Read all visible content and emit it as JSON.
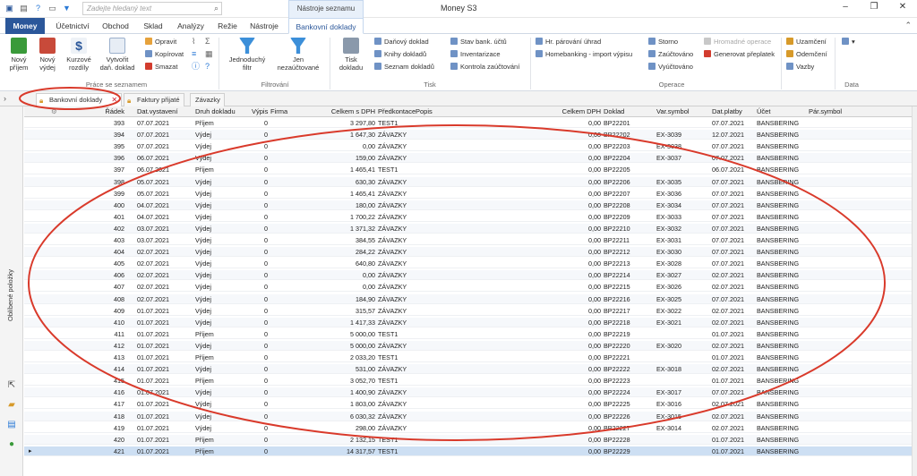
{
  "titlebar": {
    "search_placeholder": "Zadejte hledaný text",
    "app_title": "Money S3",
    "context_title": "Nástroje seznamu"
  },
  "ribbon_tabs": [
    "Money",
    "Účetnictví",
    "Obchod",
    "Sklad",
    "Analýzy",
    "Režie",
    "Nástroje",
    "Bankovní doklady"
  ],
  "ribbon": {
    "novy_prijem": "Nový",
    "novy_prijem2": "příjem",
    "novy_vydej": "Nový",
    "novy_vydej2": "výdej",
    "kurzove": "Kurzové",
    "kurzove2": "rozdíly",
    "vytvorit": "Vytvořit",
    "vytvorit2": "daň. doklad",
    "opravit": "Opravit",
    "kopirovat": "Kopírovat",
    "smazat": "Smazat",
    "group_prace": "Práce se seznamem",
    "jednoduchy": "Jednoduchý",
    "jednoduchy2": "filtr",
    "jen_nezauctovane": "Jen",
    "jen_nezauctovane2": "nezaúčtované",
    "group_filtrovani": "Filtrování",
    "tisk": "Tisk",
    "tisk2": "dokladu",
    "danovy_doklad": "Daňový doklad",
    "knihy_dokladu": "Knihy dokladů",
    "seznam_dokladu": "Seznam dokladů",
    "stav_bank": "Stav bank. účtů",
    "inventarizace": "Inventarizace",
    "kontrola": "Kontrola zaúčtování",
    "group_tisk": "Tisk",
    "hr_parovani": "Hr. párování úhrad",
    "homebanking": "Homebanking - import výpisu",
    "storno": "Storno",
    "zauctovano": "Zaúčtováno",
    "vyuctovano": "Vyúčtováno",
    "hromadne": "Hromadné operace",
    "generovat": "Generovat přeplatek",
    "group_operace": "Operace",
    "uzamceni": "Uzamčení",
    "odemceni": "Odemčení",
    "vazby": "Vazby",
    "group_data": "Data"
  },
  "doc_tabs": [
    "Bankovní doklady",
    "Faktury přijaté",
    "Závazky"
  ],
  "left_panel": {
    "label": "Oblíbené položky"
  },
  "columns": [
    "Řádek",
    "Dat.vystavení",
    "Druh dokladu",
    "Výpis",
    "Firma",
    "Celkem s DPH",
    "Předkontace",
    "Popis",
    "Celkem DPH",
    "Doklad",
    "Var.symbol",
    "Dat.platby",
    "Účet",
    "Pár.symbol"
  ],
  "rows": [
    [
      "393",
      "07.07.2021",
      "Příjem",
      "0",
      "",
      "3 297,80",
      "TEST1",
      "",
      "0,00",
      "BP22201",
      "",
      "07.07.2021",
      "BANSBERING",
      ""
    ],
    [
      "394",
      "07.07.2021",
      "Výdej",
      "0",
      "",
      "1 647,30",
      "ZÁVAZKY",
      "",
      "0,00",
      "BP22202",
      "EX-3039",
      "12.07.2021",
      "BANSBERING",
      ""
    ],
    [
      "395",
      "07.07.2021",
      "Výdej",
      "0",
      "",
      "0,00",
      "ZÁVAZKY",
      "",
      "0,00",
      "BP22203",
      "EX-3038",
      "07.07.2021",
      "BANSBERING",
      ""
    ],
    [
      "396",
      "06.07.2021",
      "Výdej",
      "0",
      "",
      "159,00",
      "ZÁVAZKY",
      "",
      "0,00",
      "BP22204",
      "EX-3037",
      "07.07.2021",
      "BANSBERING",
      ""
    ],
    [
      "397",
      "06.07.2021",
      "Příjem",
      "0",
      "",
      "1 465,41",
      "TEST1",
      "",
      "0,00",
      "BP22205",
      "",
      "06.07.2021",
      "BANSBERING",
      ""
    ],
    [
      "398",
      "05.07.2021",
      "Výdej",
      "0",
      "",
      "630,30",
      "ZÁVAZKY",
      "",
      "0,00",
      "BP22206",
      "EX-3035",
      "07.07.2021",
      "BANSBERING",
      ""
    ],
    [
      "399",
      "05.07.2021",
      "Výdej",
      "0",
      "",
      "1 465,41",
      "ZÁVAZKY",
      "",
      "0,00",
      "BP22207",
      "EX-3036",
      "07.07.2021",
      "BANSBERING",
      ""
    ],
    [
      "400",
      "04.07.2021",
      "Výdej",
      "0",
      "",
      "180,00",
      "ZÁVAZKY",
      "",
      "0,00",
      "BP22208",
      "EX-3034",
      "07.07.2021",
      "BANSBERING",
      ""
    ],
    [
      "401",
      "04.07.2021",
      "Výdej",
      "0",
      "",
      "1 700,22",
      "ZÁVAZKY",
      "",
      "0,00",
      "BP22209",
      "EX-3033",
      "07.07.2021",
      "BANSBERING",
      ""
    ],
    [
      "402",
      "03.07.2021",
      "Výdej",
      "0",
      "",
      "1 371,32",
      "ZÁVAZKY",
      "",
      "0,00",
      "BP22210",
      "EX-3032",
      "07.07.2021",
      "BANSBERING",
      ""
    ],
    [
      "403",
      "03.07.2021",
      "Výdej",
      "0",
      "",
      "384,55",
      "ZÁVAZKY",
      "",
      "0,00",
      "BP22211",
      "EX-3031",
      "07.07.2021",
      "BANSBERING",
      ""
    ],
    [
      "404",
      "02.07.2021",
      "Výdej",
      "0",
      "",
      "284,22",
      "ZÁVAZKY",
      "",
      "0,00",
      "BP22212",
      "EX-3030",
      "07.07.2021",
      "BANSBERING",
      ""
    ],
    [
      "405",
      "02.07.2021",
      "Výdej",
      "0",
      "",
      "640,80",
      "ZÁVAZKY",
      "",
      "0,00",
      "BP22213",
      "EX-3028",
      "07.07.2021",
      "BANSBERING",
      ""
    ],
    [
      "406",
      "02.07.2021",
      "Výdej",
      "0",
      "",
      "0,00",
      "ZÁVAZKY",
      "",
      "0,00",
      "BP22214",
      "EX-3027",
      "02.07.2021",
      "BANSBERING",
      ""
    ],
    [
      "407",
      "02.07.2021",
      "Výdej",
      "0",
      "",
      "0,00",
      "ZÁVAZKY",
      "",
      "0,00",
      "BP22215",
      "EX-3026",
      "02.07.2021",
      "BANSBERING",
      ""
    ],
    [
      "408",
      "02.07.2021",
      "Výdej",
      "0",
      "",
      "184,90",
      "ZÁVAZKY",
      "",
      "0,00",
      "BP22216",
      "EX-3025",
      "07.07.2021",
      "BANSBERING",
      ""
    ],
    [
      "409",
      "01.07.2021",
      "Výdej",
      "0",
      "",
      "315,57",
      "ZÁVAZKY",
      "",
      "0,00",
      "BP22217",
      "EX-3022",
      "02.07.2021",
      "BANSBERING",
      ""
    ],
    [
      "410",
      "01.07.2021",
      "Výdej",
      "0",
      "",
      "1 417,33",
      "ZÁVAZKY",
      "",
      "0,00",
      "BP22218",
      "EX-3021",
      "02.07.2021",
      "BANSBERING",
      ""
    ],
    [
      "411",
      "01.07.2021",
      "Příjem",
      "0",
      "",
      "5 000,00",
      "TEST1",
      "",
      "0,00",
      "BP22219",
      "",
      "01.07.2021",
      "BANSBERING",
      ""
    ],
    [
      "412",
      "01.07.2021",
      "Výdej",
      "0",
      "",
      "5 000,00",
      "ZÁVAZKY",
      "",
      "0,00",
      "BP22220",
      "EX-3020",
      "02.07.2021",
      "BANSBERING",
      ""
    ],
    [
      "413",
      "01.07.2021",
      "Příjem",
      "0",
      "",
      "2 033,20",
      "TEST1",
      "",
      "0,00",
      "BP22221",
      "",
      "01.07.2021",
      "BANSBERING",
      ""
    ],
    [
      "414",
      "01.07.2021",
      "Výdej",
      "0",
      "",
      "531,00",
      "ZÁVAZKY",
      "",
      "0,00",
      "BP22222",
      "EX-3018",
      "02.07.2021",
      "BANSBERING",
      ""
    ],
    [
      "415",
      "01.07.2021",
      "Příjem",
      "0",
      "",
      "3 052,70",
      "TEST1",
      "",
      "0,00",
      "BP22223",
      "",
      "01.07.2021",
      "BANSBERING",
      ""
    ],
    [
      "416",
      "01.07.2021",
      "Výdej",
      "0",
      "",
      "1 400,90",
      "ZÁVAZKY",
      "",
      "0,00",
      "BP22224",
      "EX-3017",
      "07.07.2021",
      "BANSBERING",
      ""
    ],
    [
      "417",
      "01.07.2021",
      "Výdej",
      "0",
      "",
      "1 803,00",
      "ZÁVAZKY",
      "",
      "0,00",
      "BP22225",
      "EX-3016",
      "02.07.2021",
      "BANSBERING",
      ""
    ],
    [
      "418",
      "01.07.2021",
      "Výdej",
      "0",
      "",
      "6 030,32",
      "ZÁVAZKY",
      "",
      "0,00",
      "BP22226",
      "EX-3015",
      "02.07.2021",
      "BANSBERING",
      ""
    ],
    [
      "419",
      "01.07.2021",
      "Výdej",
      "0",
      "",
      "298,00",
      "ZÁVAZKY",
      "",
      "0,00",
      "BP22227",
      "EX-3014",
      "02.07.2021",
      "BANSBERING",
      ""
    ],
    [
      "420",
      "01.07.2021",
      "Příjem",
      "0",
      "",
      "2 132,15",
      "TEST1",
      "",
      "0,00",
      "BP22228",
      "",
      "01.07.2021",
      "BANSBERING",
      ""
    ],
    [
      "421",
      "01.07.2021",
      "Příjem",
      "0",
      "",
      "14 317,57",
      "TEST1",
      "",
      "0,00",
      "BP22229",
      "",
      "01.07.2021",
      "BANSBERING",
      ""
    ]
  ],
  "selected_row": "421",
  "colors": {
    "accent": "#2b579a",
    "annotation": "#d93a2b",
    "selected": "#cddff3"
  }
}
